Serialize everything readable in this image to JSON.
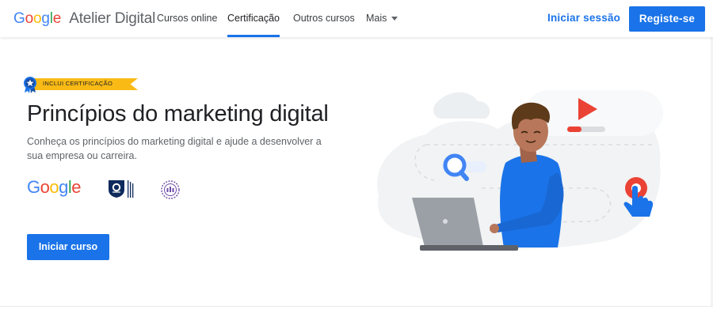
{
  "header": {
    "brand_google": "Google",
    "brand_suffix": "Atelier Digital",
    "nav": [
      {
        "label": "Cursos online"
      },
      {
        "label": "Certificação"
      },
      {
        "label": "Outros cursos"
      },
      {
        "label": "Mais"
      }
    ],
    "signin_label": "Iniciar sessão",
    "register_label": "Registe-se"
  },
  "course": {
    "badge": "INCLUI CERTIFICAÇÃO",
    "title": "Princípios do marketing digital",
    "subtitle": "Conheça os princípios do marketing digital e ajude a desenvolver a sua empresa ou carreira.",
    "partner_google": "Google",
    "cta_label": "Iniciar curso"
  },
  "colors": {
    "accent": "#1a73e8",
    "badge": "#f9ba16",
    "play": "#ea4335"
  },
  "icons": [
    "medal-icon",
    "caret-down-icon",
    "play-icon",
    "search-icon",
    "cursor-hand-icon",
    "open-university-logo",
    "iab-logo"
  ]
}
